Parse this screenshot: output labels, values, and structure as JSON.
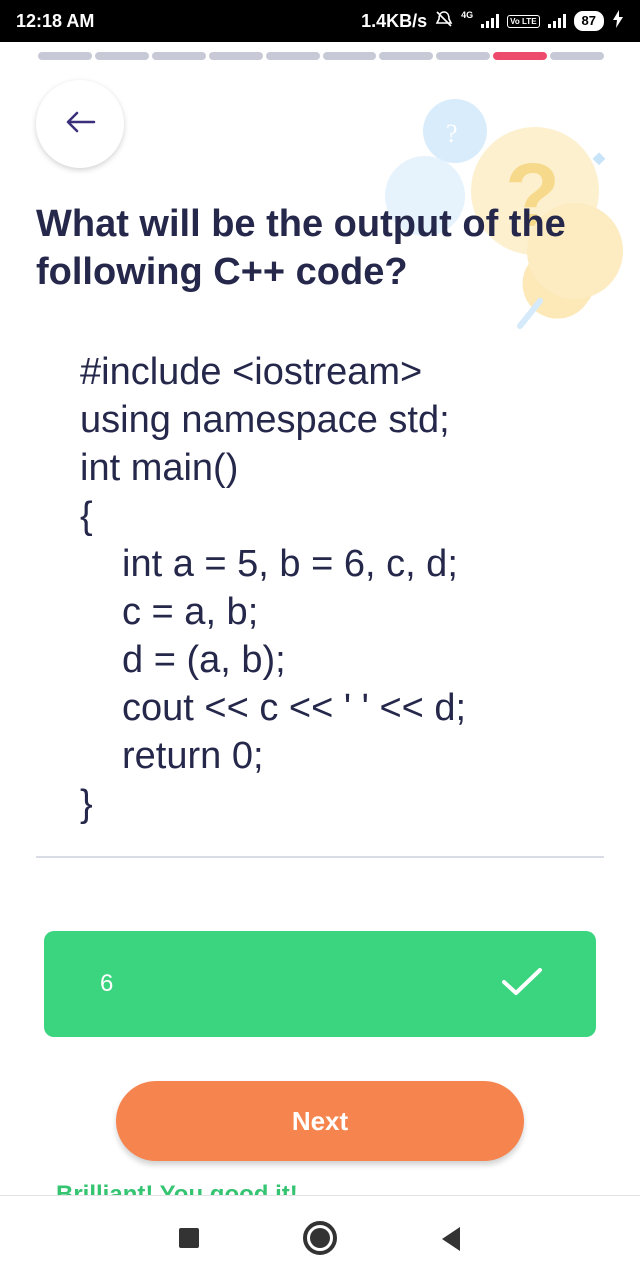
{
  "status_bar": {
    "time": "12:18 AM",
    "net_speed": "1.4KB/s",
    "network_label": "4G",
    "volte_label": "Vo LTE",
    "battery": "87"
  },
  "progress": {
    "total_steps": 10,
    "current_step": 9
  },
  "question": {
    "text": "What will be the output of the following C++ code?"
  },
  "code": {
    "lines": [
      "#include <iostream>",
      "using namespace std;",
      "int main()",
      "{",
      "int a = 5, b = 6, c, d;",
      "c = a, b;",
      "d = (a, b);",
      "cout << c << ' ' << d;",
      "return 0;",
      "}"
    ]
  },
  "answer": {
    "text": "6",
    "state": "correct"
  },
  "buttons": {
    "next": "Next"
  },
  "feedback": {
    "text": "Brilliant! You good it!"
  },
  "colors": {
    "accent_progress": "#ee4b6c",
    "correct_green": "#3bd47f",
    "next_orange": "#f6844e"
  },
  "icons": {
    "back": "arrow-left-icon",
    "answer_state": "checkmark-icon"
  }
}
